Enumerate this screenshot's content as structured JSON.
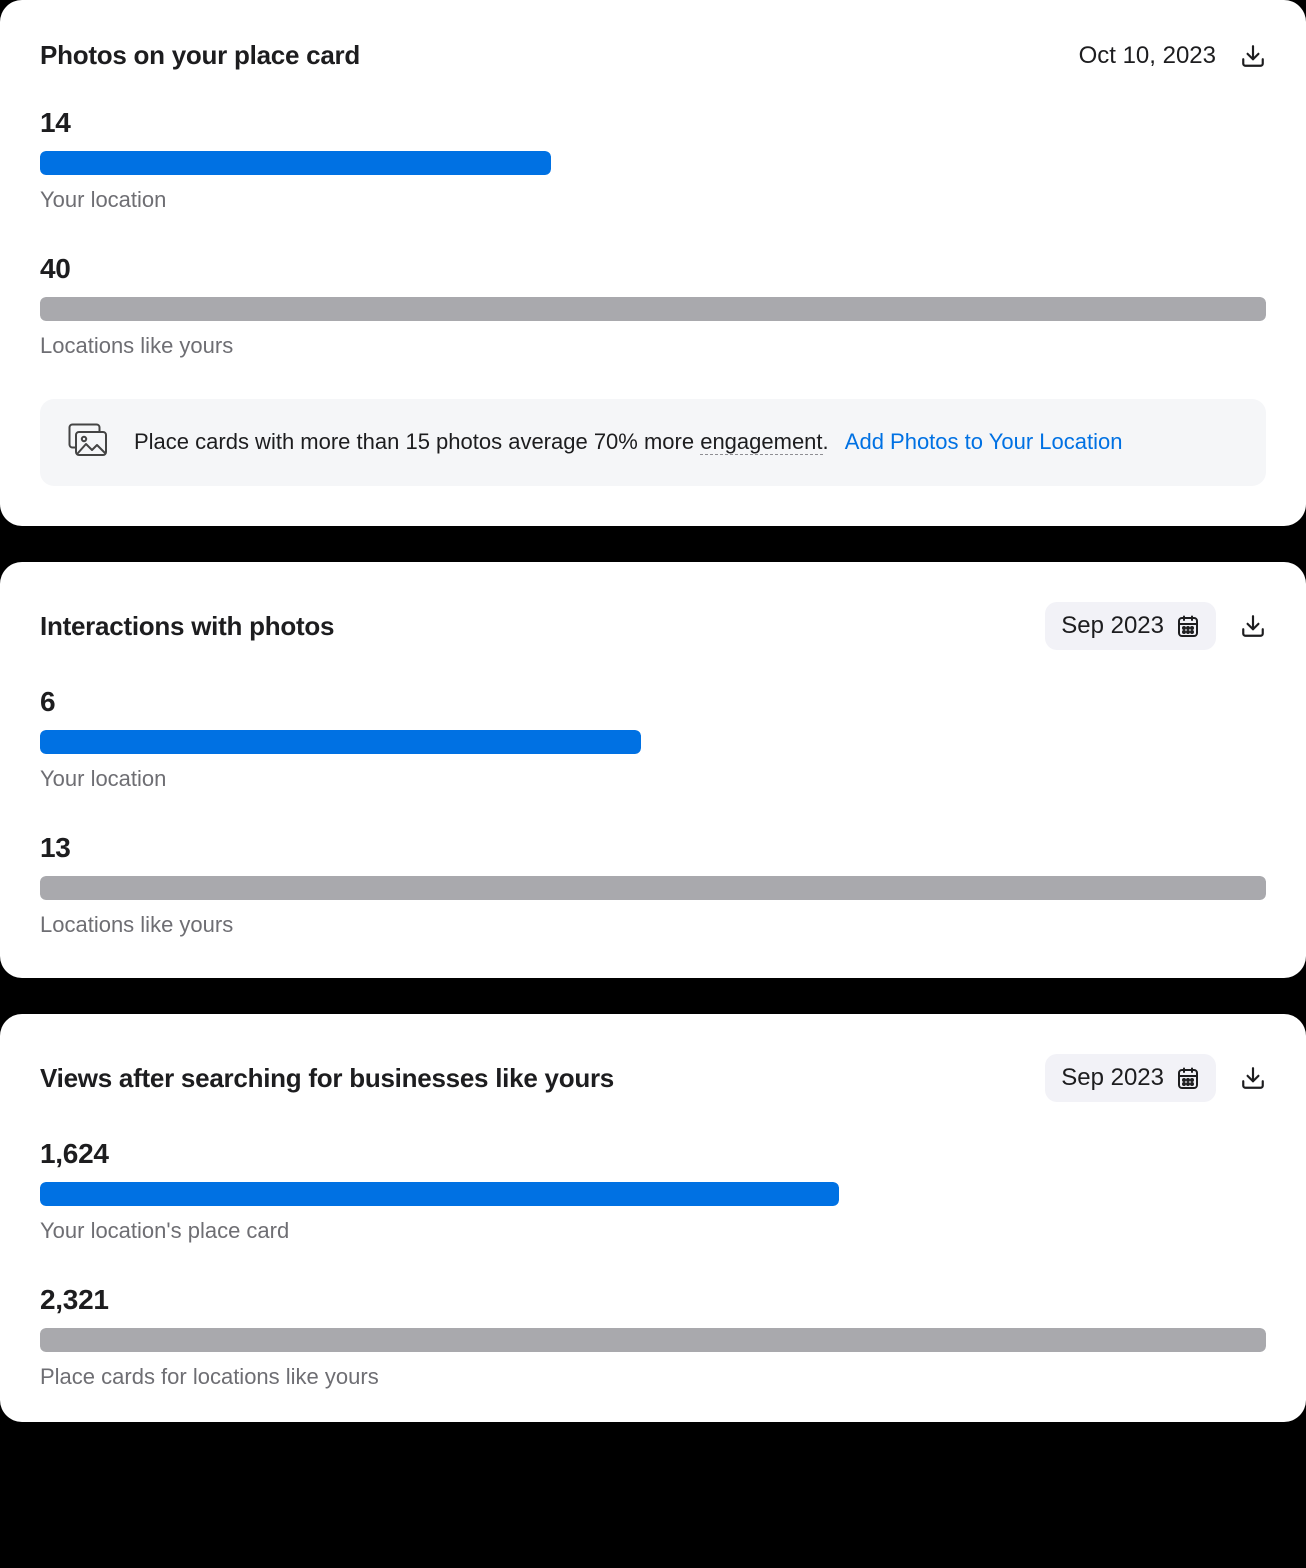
{
  "cards": [
    {
      "title": "Photos on your place card",
      "date": "Oct 10, 2023",
      "dateMode": "string",
      "metrics": [
        {
          "value": "14",
          "caption": "Your location",
          "widthPct": 41.7,
          "barColor": "blue"
        },
        {
          "value": "40",
          "caption": "Locations like yours",
          "widthPct": 100,
          "barColor": "gray"
        }
      ],
      "tip": {
        "textBefore": "Place cards with more than 15 photos average 70% more ",
        "dottedWord": "engagement",
        "textAfter": ".",
        "linkLabel": "Add Photos to Your Location"
      }
    },
    {
      "title": "Interactions with photos",
      "date": "Sep 2023",
      "dateMode": "pill",
      "metrics": [
        {
          "value": "6",
          "caption": "Your location",
          "widthPct": 49.0,
          "barColor": "blue"
        },
        {
          "value": "13",
          "caption": "Locations like yours",
          "widthPct": 100,
          "barColor": "gray"
        }
      ]
    },
    {
      "title": "Views after searching for businesses like yours",
      "date": "Sep 2023",
      "dateMode": "pill",
      "metrics": [
        {
          "value": "1,624",
          "caption": "Your location's place card",
          "widthPct": 65.2,
          "barColor": "blue"
        },
        {
          "value": "2,321",
          "caption": "Place cards for locations like yours",
          "widthPct": 100,
          "barColor": "gray"
        }
      ]
    }
  ]
}
